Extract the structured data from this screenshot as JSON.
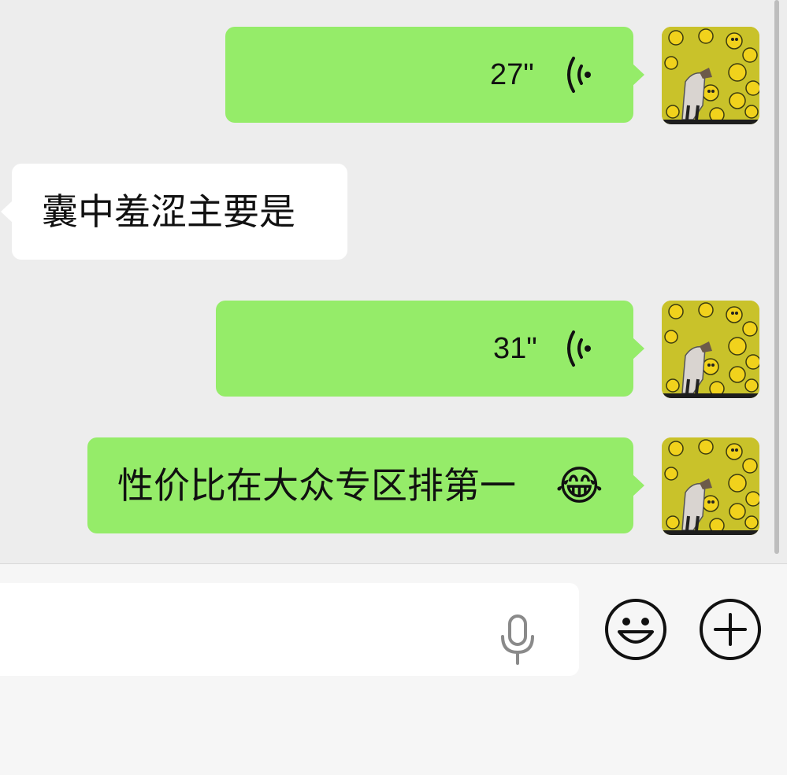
{
  "messages": [
    {
      "id": 1,
      "direction": "outgoing",
      "type": "voice",
      "duration": "27\"",
      "icon": "voice-wave-icon"
    },
    {
      "id": 2,
      "direction": "incoming",
      "type": "text",
      "text": "囊中羞涩主要是"
    },
    {
      "id": 3,
      "direction": "outgoing",
      "type": "voice",
      "duration": "31\"",
      "icon": "voice-wave-icon"
    },
    {
      "id": 4,
      "direction": "outgoing",
      "type": "text",
      "text": "性价比在大众专区排第一",
      "emoji": "😂"
    }
  ],
  "input": {
    "placeholder": "",
    "mic_icon": "microphone-icon",
    "emoji_button_icon": "smiley-icon",
    "plus_button_icon": "plus-icon"
  },
  "colors": {
    "background": "#ededed",
    "outgoing_bubble": "#95ec69",
    "incoming_bubble": "#ffffff",
    "input_bar": "#f6f6f6",
    "avatar_yellow": "#c9c22a"
  }
}
